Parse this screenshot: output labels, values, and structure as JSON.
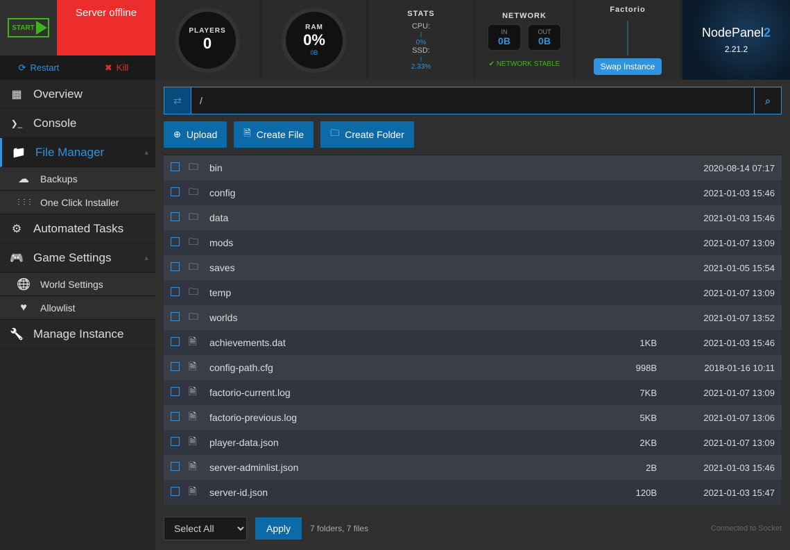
{
  "header": {
    "start_label": "START",
    "status": "Server offline",
    "restart": "Restart",
    "kill": "Kill",
    "players": {
      "label": "PLAYERS",
      "value": "0"
    },
    "ram": {
      "label": "RAM",
      "value": "0%",
      "sub": "0B"
    },
    "stats": {
      "title": "STATS",
      "cpu_label": "CPU:",
      "cpu_pct": "0%",
      "ssd_label": "SSD:",
      "ssd_pct": "2.33%"
    },
    "network": {
      "title": "NETWORK",
      "in_label": "IN",
      "in_val": "0B",
      "out_label": "OUT",
      "out_val": "0B",
      "status": "NETWORK STABLE"
    },
    "game": {
      "title": "Factorio",
      "swap": "Swap Instance"
    },
    "brand": {
      "name_a": "NodePanel",
      "name_b": "2",
      "version": "2.21.2"
    }
  },
  "sidebar": {
    "overview": "Overview",
    "console": "Console",
    "file_manager": "File Manager",
    "backups": "Backups",
    "one_click": "One Click Installer",
    "automated": "Automated Tasks",
    "game_settings": "Game Settings",
    "world_settings": "World Settings",
    "allowlist": "Allowlist",
    "manage": "Manage Instance"
  },
  "path": "/",
  "actions": {
    "upload": "Upload",
    "create_file": "Create File",
    "create_folder": "Create Folder"
  },
  "files": [
    {
      "type": "dir",
      "name": "bin",
      "size": "",
      "date": "2020-08-14 07:17"
    },
    {
      "type": "dir",
      "name": "config",
      "size": "",
      "date": "2021-01-03 15:46"
    },
    {
      "type": "dir",
      "name": "data",
      "size": "",
      "date": "2021-01-03 15:46"
    },
    {
      "type": "dir",
      "name": "mods",
      "size": "",
      "date": "2021-01-07 13:09"
    },
    {
      "type": "dir",
      "name": "saves",
      "size": "",
      "date": "2021-01-05 15:54"
    },
    {
      "type": "dir",
      "name": "temp",
      "size": "",
      "date": "2021-01-07 13:09"
    },
    {
      "type": "dir",
      "name": "worlds",
      "size": "",
      "date": "2021-01-07 13:52"
    },
    {
      "type": "file",
      "name": "achievements.dat",
      "size": "1KB",
      "date": "2021-01-03 15:46"
    },
    {
      "type": "file",
      "name": "config-path.cfg",
      "size": "998B",
      "date": "2018-01-16 10:11"
    },
    {
      "type": "file",
      "name": "factorio-current.log",
      "size": "7KB",
      "date": "2021-01-07 13:09"
    },
    {
      "type": "file",
      "name": "factorio-previous.log",
      "size": "5KB",
      "date": "2021-01-07 13:06"
    },
    {
      "type": "file",
      "name": "player-data.json",
      "size": "2KB",
      "date": "2021-01-07 13:09"
    },
    {
      "type": "file",
      "name": "server-adminlist.json",
      "size": "2B",
      "date": "2021-01-03 15:46"
    },
    {
      "type": "file",
      "name": "server-id.json",
      "size": "120B",
      "date": "2021-01-03 15:47"
    }
  ],
  "footer": {
    "select_all": "Select All",
    "apply": "Apply",
    "summary": "7 folders, 7 files",
    "socket": "Connected to Socket"
  }
}
